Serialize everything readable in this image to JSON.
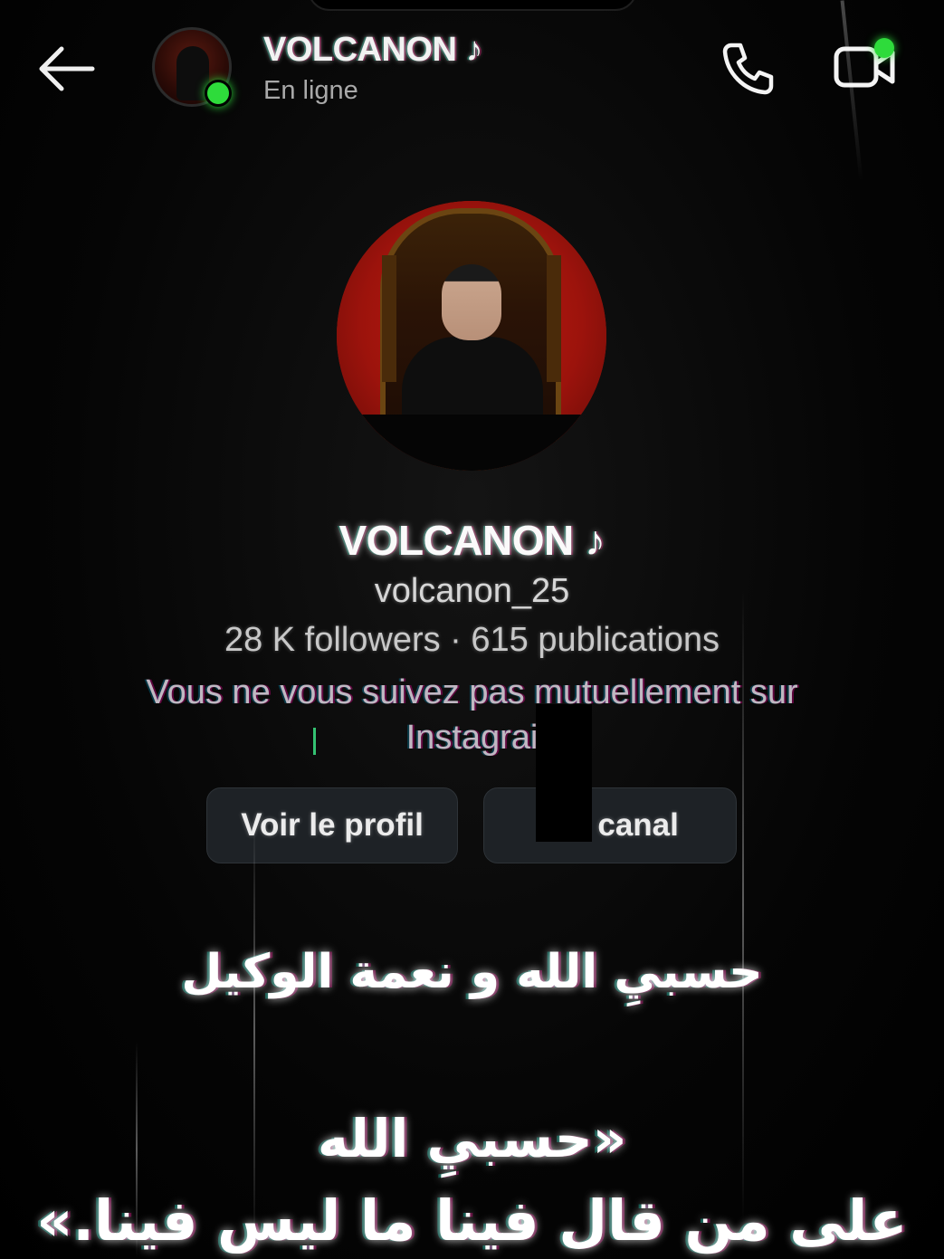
{
  "header": {
    "back_icon": "arrow-left-icon",
    "name": "VOLCANON ♪",
    "status": "En ligne",
    "call_icon": "phone-icon",
    "video_icon": "video-camera-icon",
    "online_color": "#2edb3b"
  },
  "profile": {
    "name": "VOLCANON ♪",
    "handle": "volcanon_25",
    "stats": "28 K followers · 615 publications",
    "mutual": "Vous ne vous suivez pas mutuellement sur Instagrai",
    "view_profile_label": "Voir le profil",
    "view_channel_label": "V  e canal"
  },
  "caption": {
    "line1": "حسبيِ الله و نعمة الوكيل",
    "line2": "«حسبيِ الله",
    "line3": "على من قال فينا ما ليس فينا.»"
  }
}
